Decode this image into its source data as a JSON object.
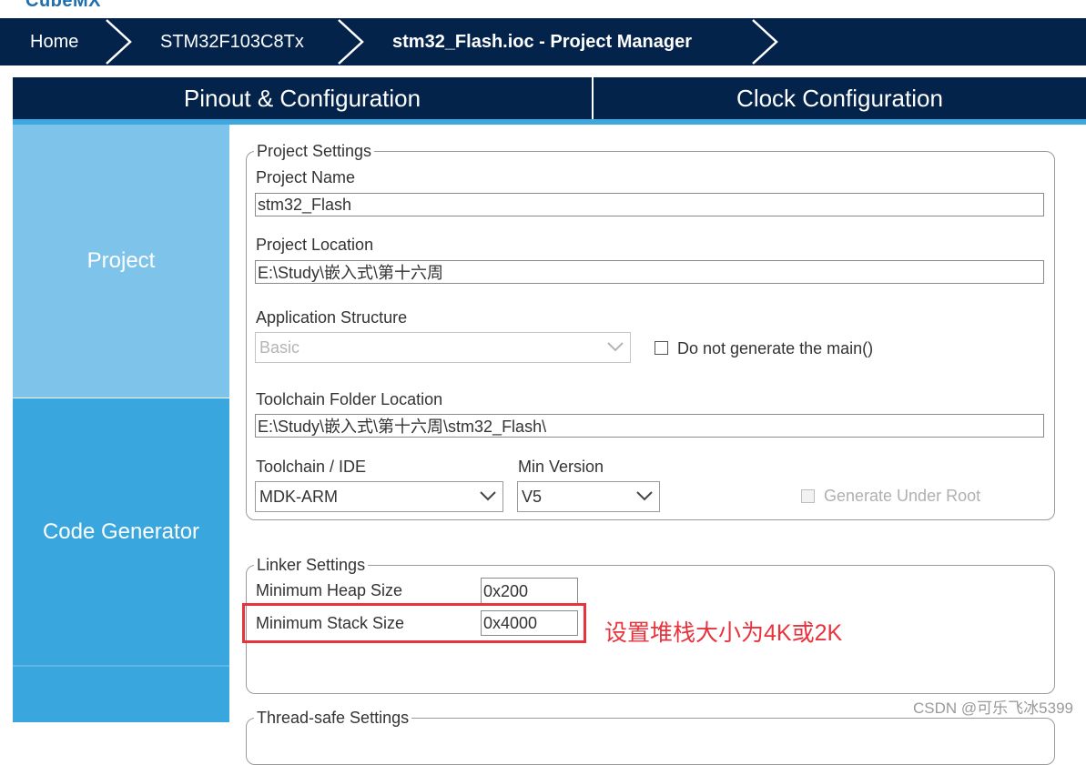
{
  "app": {
    "logo_text": "CubeMX"
  },
  "breadcrumb": {
    "items": [
      "Home",
      "STM32F103C8Tx",
      "stm32_Flash.ioc - Project Manager"
    ]
  },
  "tabs": [
    "Pinout & Configuration",
    "Clock Configuration"
  ],
  "sidebar": {
    "items": [
      "Project",
      "Code Generator",
      ""
    ]
  },
  "project_settings": {
    "legend": "Project Settings",
    "project_name_label": "Project Name",
    "project_name_value": "stm32_Flash",
    "project_location_label": "Project Location",
    "project_location_value": "E:\\Study\\嵌入式\\第十六周",
    "app_structure_label": "Application Structure",
    "app_structure_value": "Basic",
    "do_not_generate_main_label": "Do not generate the main()",
    "toolchain_folder_label": "Toolchain Folder Location",
    "toolchain_folder_value": "E:\\Study\\嵌入式\\第十六周\\stm32_Flash\\",
    "toolchain_ide_label": "Toolchain / IDE",
    "toolchain_ide_value": "MDK-ARM",
    "min_version_label": "Min Version",
    "min_version_value": "V5",
    "generate_under_root_label": "Generate Under Root"
  },
  "linker_settings": {
    "legend": "Linker Settings",
    "heap_label": "Minimum Heap Size",
    "heap_value": "0x200",
    "stack_label": "Minimum Stack Size",
    "stack_value": "0x4000"
  },
  "thread_safe": {
    "legend": "Thread-safe Settings"
  },
  "annotation": {
    "text": "设置堆栈大小为4K或2K",
    "color": "#e8323c"
  },
  "watermark": "CSDN @可乐飞冰5399",
  "colors": {
    "navy": "#03234b",
    "sidebar_light": "#7ec4ea",
    "sidebar_dark": "#39a6dd",
    "accent_red": "#e8323c"
  }
}
